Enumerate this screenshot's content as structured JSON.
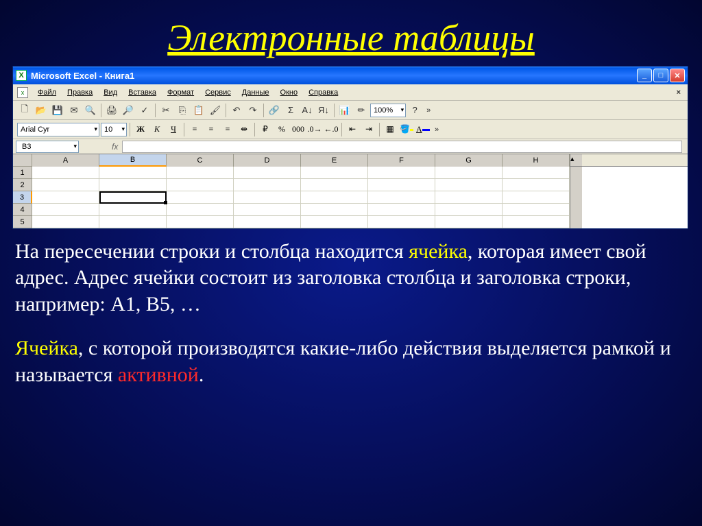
{
  "slide": {
    "title": "Электронные таблицы"
  },
  "window": {
    "title": "Microsoft Excel - Книга1"
  },
  "menu": {
    "file": "Файл",
    "edit": "Правка",
    "view": "Вид",
    "insert": "Вставка",
    "format": "Формат",
    "tools": "Сервис",
    "data": "Данные",
    "window": "Окно",
    "help": "Справка"
  },
  "toolbar": {
    "zoom": "100%"
  },
  "format": {
    "font": "Arial Cyr",
    "size": "10",
    "bold": "Ж",
    "italic": "К",
    "underline": "Ч"
  },
  "namebox": {
    "cell_ref": "B3",
    "fx": "fx"
  },
  "columns": [
    "A",
    "B",
    "C",
    "D",
    "E",
    "F",
    "G",
    "H"
  ],
  "rows": [
    "1",
    "2",
    "3",
    "4",
    "5"
  ],
  "selected": {
    "col": "B",
    "row": "3"
  },
  "caption1": {
    "part1": "На пересечении строки и столбца находится ",
    "cell": "ячейка",
    "part2": ", которая имеет свой адрес. Адрес ячейки состоит из заголовка столбца  и заголовка строки, например: А1, В5, …"
  },
  "caption2": {
    "cell": "Ячейка",
    "part1": ",  с которой производятся какие-либо действия выделяется рамкой и называется ",
    "active": "активной",
    "dot": "."
  }
}
